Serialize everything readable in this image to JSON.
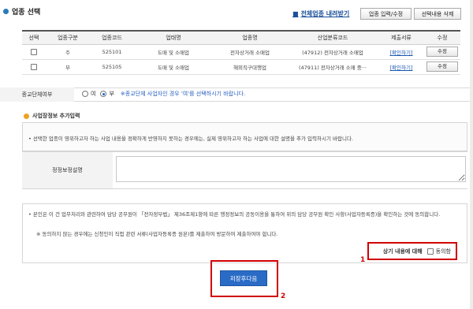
{
  "section": {
    "title": "업종 선택"
  },
  "toolbar": {
    "all_industries_prefix": "■",
    "all_industries_link": "전체업종 내려받기",
    "edit_button": "업종 입력/수정",
    "delete_button": "선택내용 삭제"
  },
  "table": {
    "headers": [
      "선택",
      "업종구분",
      "업종코드",
      "업태명",
      "업종명",
      "산업분류코드",
      "제출서류",
      "수정"
    ],
    "rows": [
      {
        "type": "주",
        "code": "525101",
        "business": "도매 및 소매업",
        "industry": "전자상거래 소매업",
        "class_code": "(47912) 전자상거래 소매업",
        "doc_link": "[확인하기]",
        "edit_label": "수정"
      },
      {
        "type": "부",
        "code": "525105",
        "business": "도매 및 소매업",
        "industry": "해외직구대행업",
        "class_code": "(47911) 전자상거래 소매 중···",
        "doc_link": "[확인하기]",
        "edit_label": "수정"
      }
    ]
  },
  "closed_business": {
    "label": "종교단체여부",
    "option_yes": "여",
    "option_no": "부",
    "selected": "부",
    "hint": "※종교단체 사업자인 경우 '여'를 선택하시기 바랍니다."
  },
  "extra_info": {
    "title": "사업장정보 추가입력",
    "description": "선택한 업종이 영위하고자 하는 사업 내용을 정확하게 반영하지 못하는 경우에는, 실제 영위하고자 하는 사업에 대한 설명을 추가 입력하시기 바랍니다.",
    "correction_label": "정정보정설명"
  },
  "consent": {
    "line1": "본인은 이 건 업무처리와 관련하여 담당 공무원이 「전자정부법」 제36조제1항에 따른 행정정보의 공동이용을 통하여 위의 담당 공무원 확인 사항(사업자등록증)을 확인하는 것에 동의합니다.",
    "line2": "※ 동의하지 않는 경우에는 신청인이 직접 관련 서류(사업자등록증 원본)를 제출하여 방문하여 제출하여야 합니다.",
    "agree_prefix": "상기 내용에 대해",
    "agree_label": "동의함"
  },
  "annotations": {
    "mark1": "1",
    "mark2": "2"
  },
  "actions": {
    "save_next": "저장후다음"
  },
  "colors": {
    "accent_blue": "#2a6bc6",
    "highlight_red": "#d10000",
    "link_blue": "#1a55b0"
  }
}
